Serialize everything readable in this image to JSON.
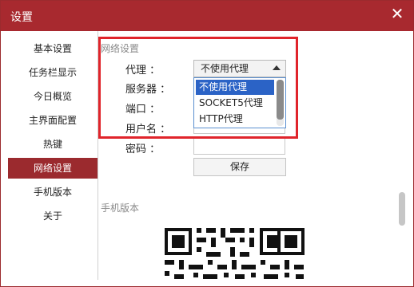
{
  "window": {
    "title": "设置",
    "close_glyph": "✕"
  },
  "sidebar": {
    "items": [
      {
        "label": "基本设置",
        "active": false
      },
      {
        "label": "任务栏显示",
        "active": false
      },
      {
        "label": "今日概览",
        "active": false
      },
      {
        "label": "主界面配置",
        "active": false
      },
      {
        "label": "热键",
        "active": false
      },
      {
        "label": "网络设置",
        "active": true
      },
      {
        "label": "手机版本",
        "active": false
      },
      {
        "label": "关于",
        "active": false
      }
    ]
  },
  "network": {
    "section_title": "网络设置",
    "proxy_label": "代理 ：",
    "server_label": "服务器 ：",
    "port_label": "端口 ：",
    "username_label": "用户名 ：",
    "password_label": "密码 ：",
    "proxy_value": "不使用代理",
    "proxy_options": [
      "不使用代理",
      "SOCKET5代理",
      "HTTP代理"
    ],
    "save_label": "保存"
  },
  "mobile": {
    "section_title": "手机版本"
  },
  "colors": {
    "brand": "#a8292f",
    "active": "#9b2a2e",
    "highlight": "#e0242b",
    "selection": "#2b63c6"
  }
}
